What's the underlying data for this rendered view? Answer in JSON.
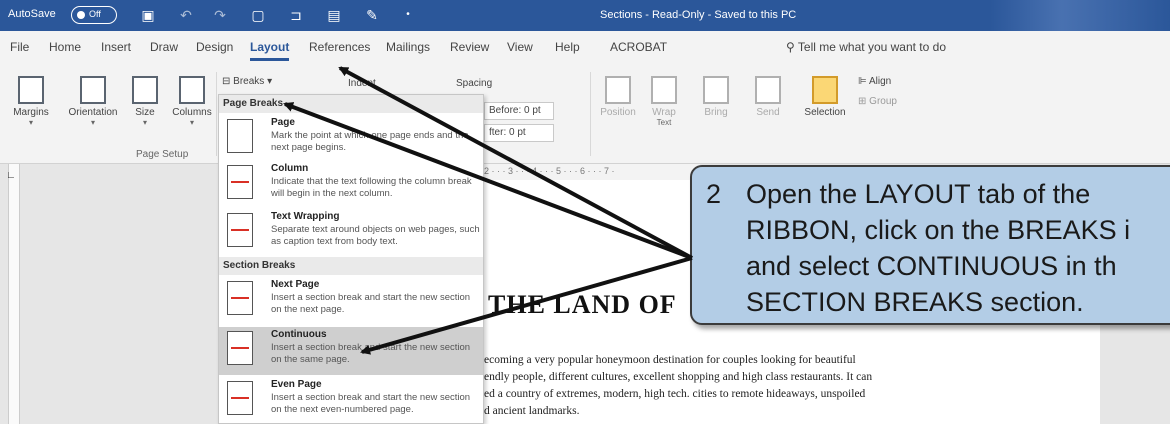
{
  "titlebar": {
    "autosave_label": "AutoSave",
    "autosave_state": "Off",
    "doc_title": "Sections  -  Read-Only  -  Saved to this PC"
  },
  "tabs": [
    "File",
    "Home",
    "Insert",
    "Draw",
    "Design",
    "Layout",
    "References",
    "Mailings",
    "Review",
    "View",
    "Help",
    "ACROBAT"
  ],
  "active_tab": "Layout",
  "tellme": "Tell me what you want to do",
  "ribbon": {
    "margins": "Margins",
    "orientation": "Orientation",
    "size": "Size",
    "columns": "Columns",
    "page_setup": "Page Setup",
    "breaks": "Breaks",
    "indent": "Indent",
    "spacing": "Spacing",
    "before": "Before: 0 pt",
    "after": "fter:  0 pt",
    "position": "Position",
    "wrap": "Wrap",
    "wrap_sub": "Text",
    "bring": "Bring",
    "send": "Send",
    "selection": "Selection",
    "align": "Align",
    "group": "Group"
  },
  "dropdown": {
    "page_breaks_header": "Page Breaks",
    "section_breaks_header": "Section Breaks",
    "items": [
      {
        "title": "Page",
        "desc": "Mark the point at which one page ends and the next page begins."
      },
      {
        "title": "Column",
        "desc": "Indicate that the text following the column break will begin in the next column."
      },
      {
        "title": "Text Wrapping",
        "desc": "Separate text around objects on web pages, such as caption text from body text."
      },
      {
        "title": "Next Page",
        "desc": "Insert a section break and start the new section on the next page."
      },
      {
        "title": "Continuous",
        "desc": "Insert a section break and start the new section on the same page."
      },
      {
        "title": "Even Page",
        "desc": "Insert a section break and start the new section on the next even-numbered page."
      }
    ]
  },
  "ruler_text": "2 · · · 3 · · · 4 · · · 5 · · · 6 · · · 7 ·",
  "document": {
    "heading": "THE LAND OF",
    "lines": [
      "ecoming a very popular honeymoon destination for couples looking for beautiful",
      "endly people, different cultures, excellent shopping and high class restaurants. It can",
      "ed a country of extremes, modern, high tech. cities to remote hideaways, unspoiled",
      "d ancient landmarks."
    ]
  },
  "callout": {
    "number": "2",
    "lines": [
      "Open the LAYOUT tab of the",
      "RIBBON, click on the BREAKS i",
      "and select CONTINUOUS in th",
      "SECTION BREAKS section."
    ]
  }
}
